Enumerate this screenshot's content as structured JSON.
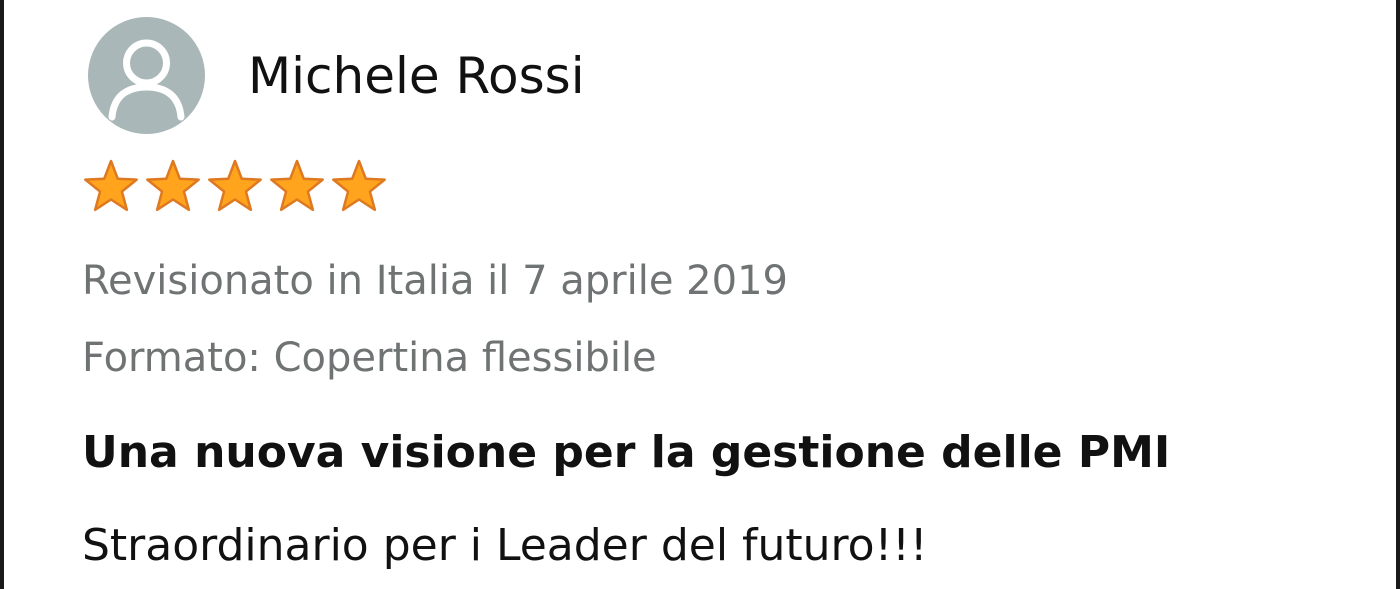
{
  "review": {
    "reviewer_name": "Michele Rossi",
    "avatar_icon": "user-silhouette-icon",
    "rating": 5,
    "rating_max": 5,
    "star_color": "#ffa41c",
    "star_outline_color": "#de7921",
    "review_location_date": "Revisionato in Italia il 7 aprile 2019",
    "format": "Formato: Copertina flessibile",
    "title": "Una nuova visione per la gestione delle PMI",
    "body": "Straordinario per i Leader del futuro!!!"
  }
}
